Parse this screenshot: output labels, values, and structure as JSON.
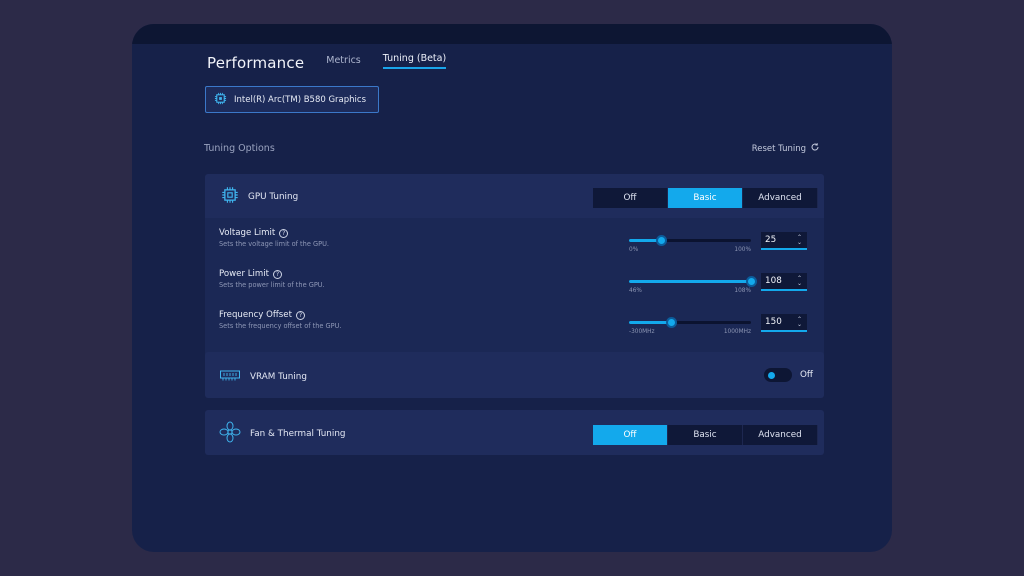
{
  "header": {
    "title": "Performance",
    "tabs": [
      {
        "label": "Metrics",
        "active": false
      },
      {
        "label": "Tuning (Beta)",
        "active": true
      }
    ]
  },
  "gpu_selector": {
    "label": "Intel(R) Arc(TM) B580 Graphics",
    "icon": "chip-icon"
  },
  "tuning_options": {
    "title": "Tuning Options",
    "reset_label": "Reset Tuning",
    "reset_icon": "refresh-icon"
  },
  "gpu_tuning": {
    "label": "GPU Tuning",
    "icon": "chip-icon",
    "modes": [
      "Off",
      "Basic",
      "Advanced"
    ],
    "selected_mode": "Basic",
    "rows": [
      {
        "label": "Voltage Limit",
        "help": "?",
        "desc": "Sets the voltage limit of the GPU.",
        "min": "0%",
        "max": "100%",
        "value": "25",
        "fraction": 0.27
      },
      {
        "label": "Power Limit",
        "help": "?",
        "desc": "Sets the power limit of the GPU.",
        "min": "46%",
        "max": "108%",
        "value": "108",
        "fraction": 1.0
      },
      {
        "label": "Frequency Offset",
        "help": "?",
        "desc": "Sets the frequency offset of the GPU.",
        "min": "-300MHz",
        "max": "1000MHz",
        "value": "150",
        "fraction": 0.35
      }
    ]
  },
  "vram_tuning": {
    "label": "VRAM Tuning",
    "icon": "memory-icon",
    "toggle_state": "Off"
  },
  "fan_tuning": {
    "label": "Fan & Thermal Tuning",
    "icon": "fan-icon",
    "modes": [
      "Off",
      "Basic",
      "Advanced"
    ],
    "selected_mode": "Off"
  },
  "colors": {
    "accent": "#13a9ec",
    "panel": "#1f2c5c",
    "background": "#162149"
  }
}
